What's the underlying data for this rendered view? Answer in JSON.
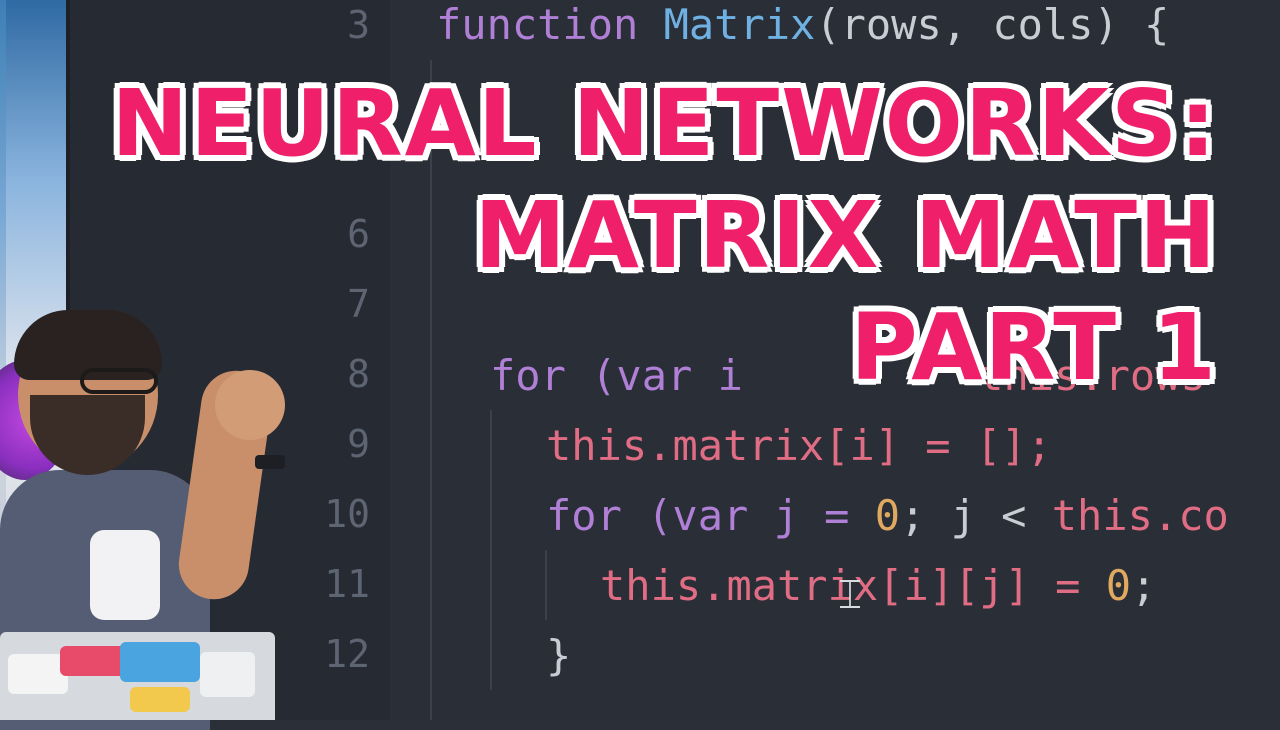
{
  "title": {
    "line1": "NEURAL NETWORKS:",
    "line2": "MATRIX MATH",
    "line3": "PART 1"
  },
  "gutter": [
    "3",
    "6",
    "7",
    "8",
    "9",
    "10",
    "11",
    "12"
  ],
  "code": {
    "line3_kw": "function",
    "line3_fn": "Matrix",
    "line3_rest": "(rows, cols) {",
    "line8_kw": "for",
    "line8_a": " (var i ",
    "line8_b": "this.",
    "line8_c": "rows",
    "line9_this": "this",
    "line9_rest": ".matrix[i] = [];",
    "line10_kw": "for",
    "line10_a": " (var j = ",
    "line10_num": "0",
    "line10_b": "; j < ",
    "line10_this": "this",
    "line10_c": ".co",
    "line11_this": "this",
    "line11_rest": ".matrix[i][j] = ",
    "line11_num": "0",
    "line11_end": ";",
    "line12": "}"
  },
  "icons": {
    "cursor": "text-cursor-icon"
  }
}
